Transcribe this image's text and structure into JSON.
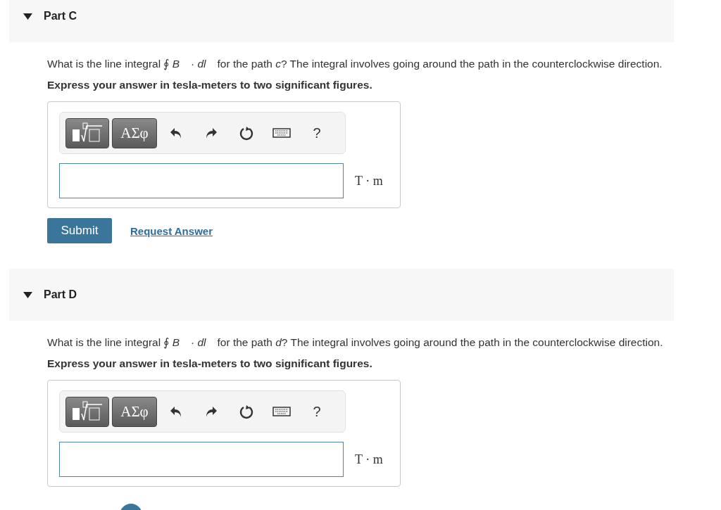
{
  "parts": [
    {
      "title": "Part C",
      "expanded": true,
      "question": "What is the line integral ∮ *B⃗* · *dl⃗* for the path *c*? The integral involves going around the path in the counterclockwise direction.",
      "instruction": "Express your answer in tesla-meters to two significant figures.",
      "toolbar": {
        "greek": "ΑΣφ",
        "help": "?"
      },
      "unit": "T · m",
      "actions": {
        "submit": "Submit",
        "link": "Request Answer"
      }
    },
    {
      "title": "Part D",
      "expanded": true,
      "question": "What is the line integral ∮ *B⃗* · *dl⃗* for the path *d*? The integral involves going around the path in the counterclockwise direction.",
      "instruction": "Express your answer in tesla-meters to two significant figures.",
      "toolbar": {
        "greek": "ΑΣφ",
        "help": "?"
      },
      "unit": "T · m"
    }
  ]
}
